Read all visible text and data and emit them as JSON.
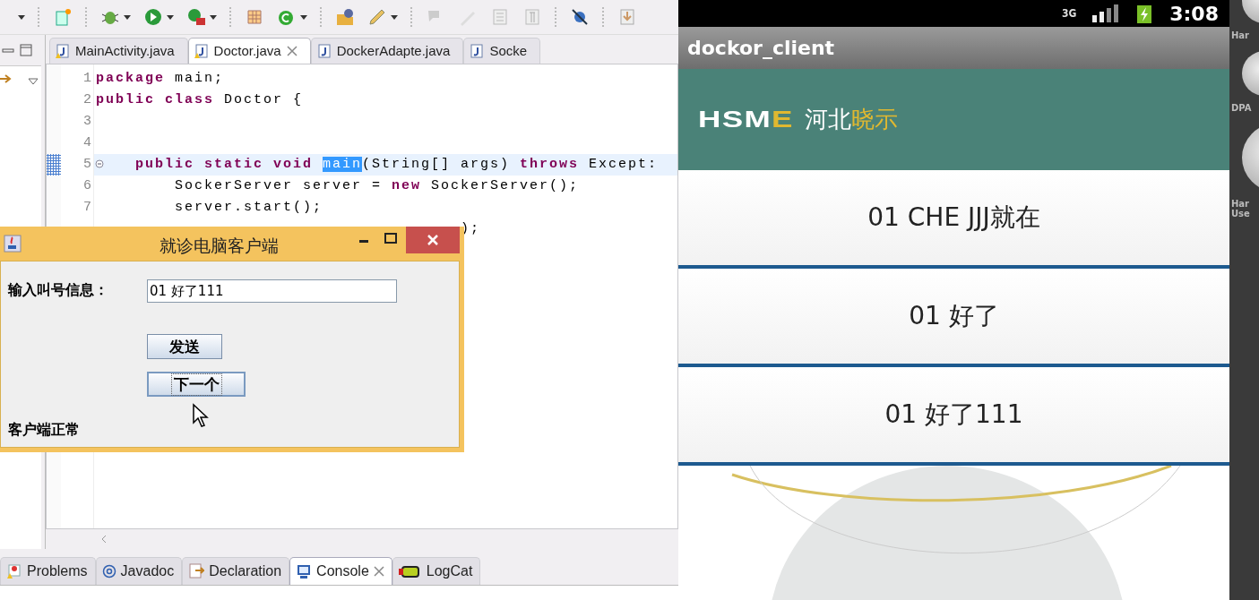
{
  "editor": {
    "tabs": [
      {
        "label": "MainActivity.java",
        "selected": false,
        "closable": false
      },
      {
        "label": "Doctor.java",
        "selected": true,
        "closable": true
      },
      {
        "label": "DockerAdapte.java",
        "selected": false,
        "closable": false
      },
      {
        "label": "Socke",
        "selected": false,
        "closable": false
      }
    ],
    "lines": [
      {
        "number": "1",
        "current": false,
        "foldable": false,
        "segments": [
          {
            "kind": "kw",
            "text": "package"
          },
          {
            "kind": "plain",
            "text": " main;"
          }
        ]
      },
      {
        "number": "2",
        "current": false,
        "foldable": false,
        "segments": [
          {
            "kind": "kw",
            "text": "public class"
          },
          {
            "kind": "plain",
            "text": " Doctor {"
          }
        ]
      },
      {
        "number": "3",
        "current": false,
        "foldable": false
      },
      {
        "number": "4",
        "current": false,
        "foldable": false
      },
      {
        "number": "5",
        "current": true,
        "foldable": true,
        "segments": [
          {
            "kind": "kw",
            "text": "    public static void "
          },
          {
            "kind": "sel",
            "text": "main"
          },
          {
            "kind": "plain",
            "text": "(String[] args) "
          },
          {
            "kind": "kw",
            "text": "throws"
          },
          {
            "kind": "plain",
            "text": " Except:"
          }
        ]
      },
      {
        "number": "6",
        "current": false,
        "foldable": false,
        "segments": [
          {
            "kind": "plain",
            "text": "        SockerServer server = "
          },
          {
            "kind": "kw",
            "text": "new"
          },
          {
            "kind": "plain",
            "text": " SockerServer();"
          }
        ]
      },
      {
        "number": "7",
        "current": false,
        "foldable": false,
        "segments": [
          {
            "kind": "plain",
            "text": "        server.start();"
          }
        ]
      },
      {
        "current": false,
        "foldable": false,
        "segments": [
          {
            "kind": "plain",
            "text": "                                     );"
          }
        ]
      }
    ]
  },
  "bottom_tabs": [
    {
      "label": "Problems",
      "selected": false,
      "closable": false
    },
    {
      "label": "Javadoc",
      "selected": false,
      "closable": false
    },
    {
      "label": "Declaration",
      "selected": false,
      "closable": false
    },
    {
      "label": "Console",
      "selected": true,
      "closable": true
    },
    {
      "label": "LogCat",
      "selected": false,
      "closable": false
    }
  ],
  "dialog": {
    "title": "就诊电脑客户端",
    "field_label": "输入叫号信息：",
    "field_value": "01 好了111",
    "buttons": [
      {
        "label": "发送",
        "focused": false
      },
      {
        "label": "下一个",
        "focused": true
      }
    ],
    "status": "客户端正常"
  },
  "phone": {
    "status_bar": {
      "network": "3G",
      "time": "3:08"
    },
    "app_title": "dockor_client",
    "banner": {
      "logo": [
        {
          "text": "HSM",
          "accent": false
        },
        {
          "text": "E",
          "accent": true
        }
      ],
      "name": [
        {
          "text": "河北",
          "accent": false
        },
        {
          "text": "晓示",
          "accent": true
        }
      ]
    },
    "messages": [
      "01 CHE JJJ就在",
      "01 好了",
      "01 好了111"
    ]
  },
  "emulator_panel": {
    "labels": [
      "Har",
      "DPA",
      "Har\nUse"
    ]
  }
}
